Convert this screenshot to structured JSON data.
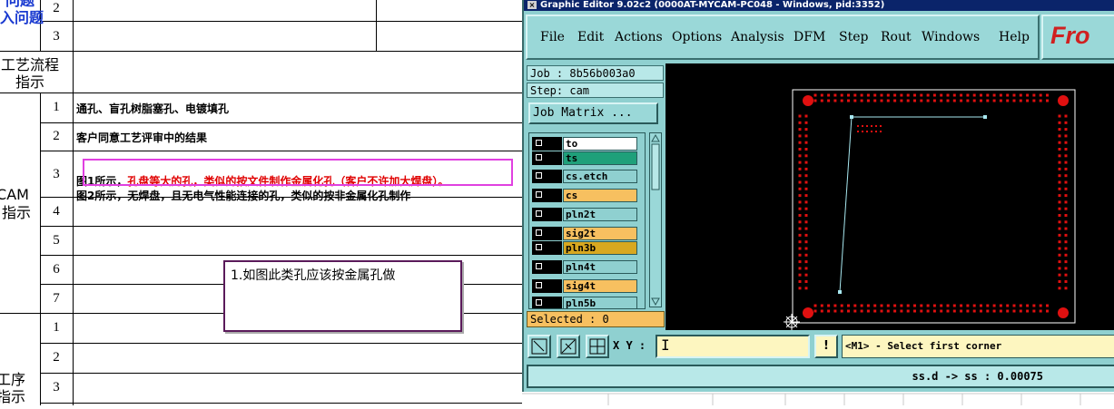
{
  "sheet": {
    "header_top": "问题",
    "header_top2": "入问题",
    "row_nums_top": [
      "2",
      "3"
    ],
    "process_flow": [
      "工艺流程",
      "指示"
    ],
    "cam_section": [
      "CAM",
      "指示"
    ],
    "cam_rows": [
      "1",
      "2",
      "3",
      "4",
      "5",
      "6",
      "7"
    ],
    "cam_text_1": "通孔、盲孔树脂塞孔、电镀填孔",
    "cam_text_2": "客户同意工艺评审中的结果",
    "cam_text_3_prefix": "图1所示，",
    "cam_text_3_red": "孔盘等大的孔，类似的按文件制作金属化孔（客户不许加大焊盘）。",
    "cam_text_4": "图2所示，无焊盘，且无电气性能连接的孔，类似的按非金属化孔制作",
    "proc_section": [
      "工序",
      "指示"
    ],
    "proc_rows": [
      "1",
      "2",
      "3"
    ],
    "note": "1.如图此类孔应该按金属孔做"
  },
  "cam": {
    "title": "Graphic Editor 9.02c2 (0000AT-MYCAM-PC048 - Windows, pid:3352)",
    "menu": [
      "File",
      "Edit",
      "Actions",
      "Options",
      "Analysis",
      "DFM",
      "Step",
      "Rout",
      "Windows",
      "Help"
    ],
    "logo": "Fro",
    "job": "Job : 8b56b003a0",
    "step": "Step: cam",
    "job_matrix": "Job Matrix ...",
    "layers": [
      {
        "name": "to",
        "color": "#ffffff"
      },
      {
        "name": "ts",
        "color": "#1fa07a"
      },
      {
        "name": "cs.etch",
        "color": "#8fd0d0"
      },
      {
        "name": "cs",
        "color": "#f7c060"
      },
      {
        "name": "pln2t",
        "color": "#8fd0d0"
      },
      {
        "name": "sig2t",
        "color": "#f7c060"
      },
      {
        "name": "pln3b",
        "color": "#d8a820"
      },
      {
        "name": "pln4t",
        "color": "#8fd0d0"
      },
      {
        "name": "sig4t",
        "color": "#f7c060"
      },
      {
        "name": "pln5b",
        "color": "#8fd0d0"
      }
    ],
    "selected": "Selected : 0",
    "xy_label": "X Y :",
    "message": "<M1> - Select first corner",
    "status": "ss.d -> ss : 0.00075",
    "pad_color": "#e01010",
    "line_color": "#a8e8f0"
  }
}
